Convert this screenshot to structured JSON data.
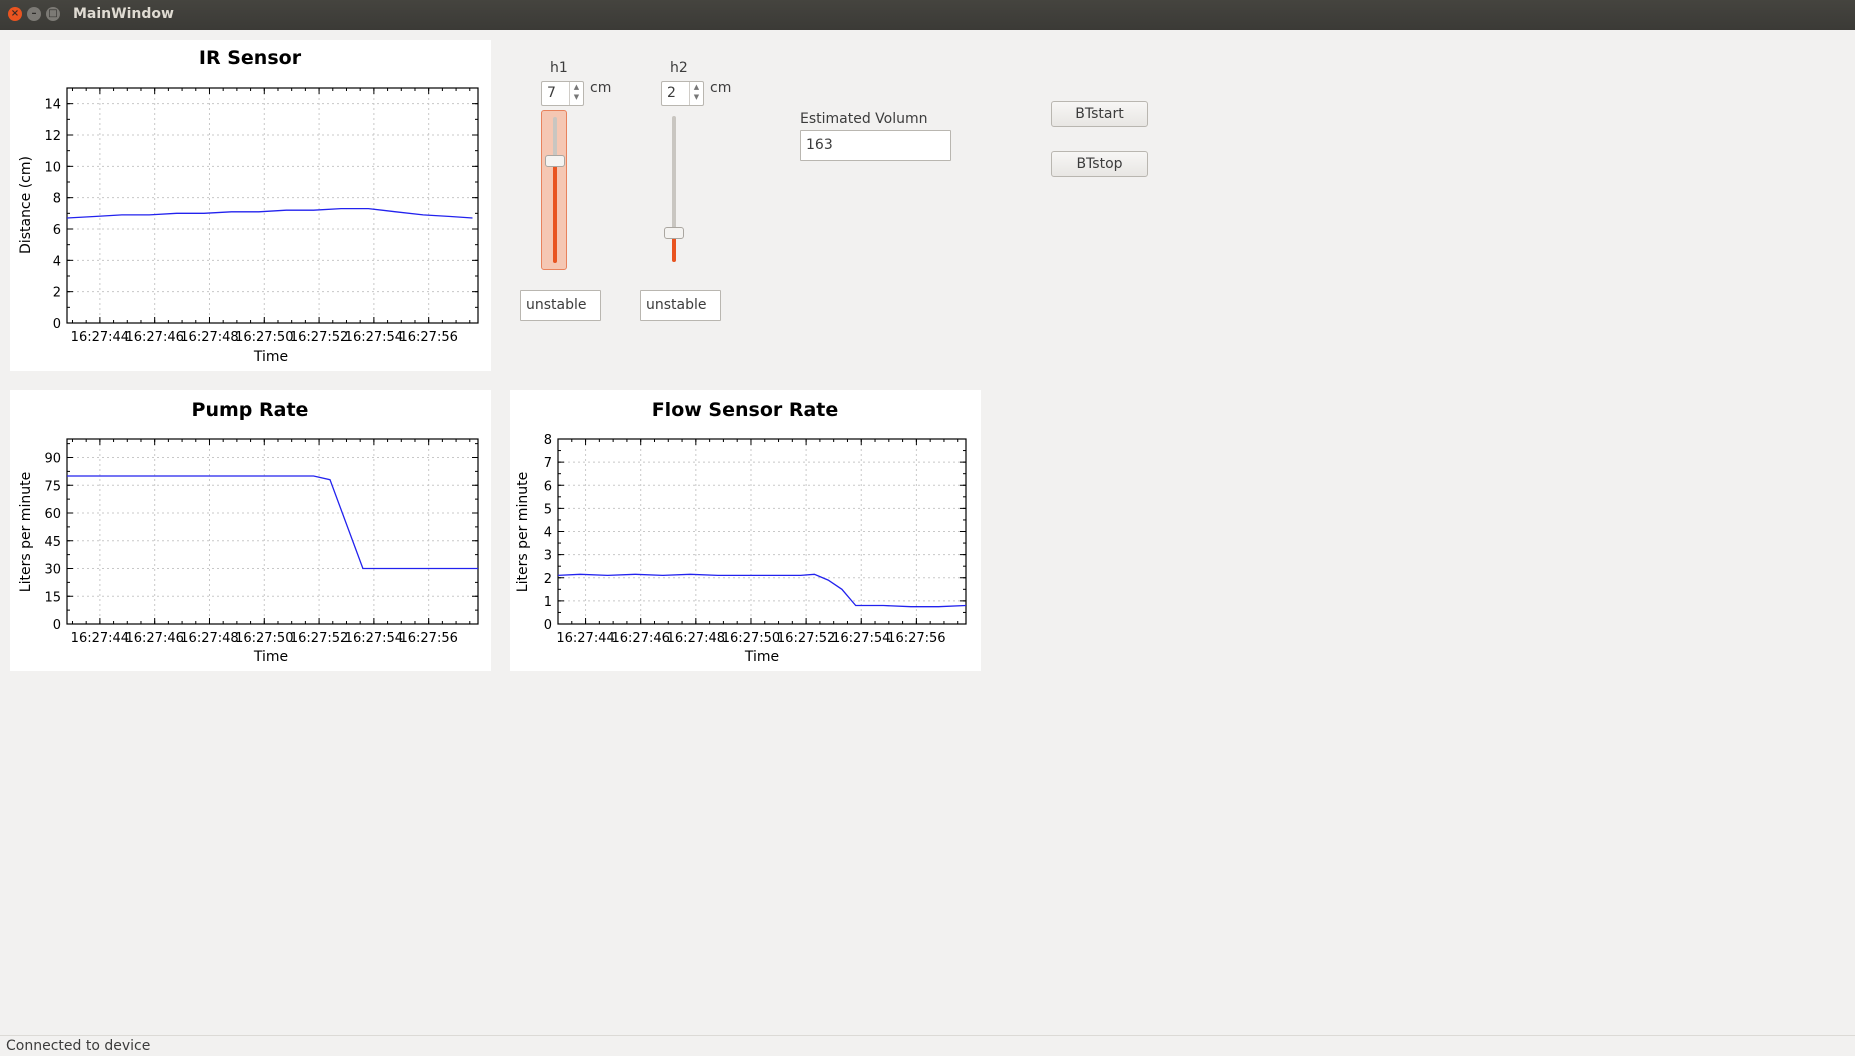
{
  "window": {
    "title": "MainWindow"
  },
  "charts": {
    "ir": {
      "title": "IR Sensor",
      "xlabel": "Time",
      "ylabel": "Distance (cm)",
      "ylim": [
        0,
        15
      ],
      "yticks": [
        0,
        2,
        4,
        6,
        8,
        10,
        12,
        14
      ],
      "xticks": [
        "16:27:44",
        "16:27:46",
        "16:27:48",
        "16:27:50",
        "16:27:52",
        "16:27:54",
        "16:27:56"
      ]
    },
    "pump": {
      "title": "Pump Rate",
      "xlabel": "Time",
      "ylabel": "Liters per minute",
      "ylim": [
        0,
        100
      ],
      "yticks": [
        0,
        15,
        30,
        45,
        60,
        75,
        90
      ],
      "xticks": [
        "16:27:44",
        "16:27:46",
        "16:27:48",
        "16:27:50",
        "16:27:52",
        "16:27:54",
        "16:27:56"
      ]
    },
    "flow": {
      "title": "Flow Sensor Rate",
      "xlabel": "Time",
      "ylabel": "Liters per minute",
      "ylim": [
        0,
        8
      ],
      "yticks": [
        0,
        1,
        2,
        3,
        4,
        5,
        6,
        7,
        8
      ],
      "xticks": [
        "16:27:44",
        "16:27:46",
        "16:27:48",
        "16:27:50",
        "16:27:52",
        "16:27:54",
        "16:27:56"
      ]
    }
  },
  "chart_data": [
    {
      "type": "line",
      "title": "IR Sensor",
      "xlabel": "Time",
      "ylabel": "Distance (cm)",
      "xlim": [
        42.8,
        57.8
      ],
      "ylim": [
        0,
        15
      ],
      "grid": true,
      "color": "#0000ff",
      "x": [
        42.8,
        43.8,
        44.8,
        45.8,
        46.8,
        47.8,
        48.8,
        49.8,
        50.8,
        51.8,
        52.8,
        53.8,
        54.8,
        55.8,
        56.8,
        57.6
      ],
      "y": [
        6.7,
        6.8,
        6.9,
        6.9,
        7.0,
        7.0,
        7.1,
        7.1,
        7.2,
        7.2,
        7.3,
        7.3,
        7.1,
        6.9,
        6.8,
        6.7
      ]
    },
    {
      "type": "line",
      "title": "Pump Rate",
      "xlabel": "Time",
      "ylabel": "Liters per minute",
      "xlim": [
        42.8,
        57.8
      ],
      "ylim": [
        0,
        100
      ],
      "grid": true,
      "color": "#0000ff",
      "x": [
        42.8,
        51.8,
        52.4,
        53.6,
        57.8
      ],
      "y": [
        80,
        80,
        78,
        30,
        30
      ]
    },
    {
      "type": "line",
      "title": "Flow Sensor Rate",
      "xlabel": "Time",
      "ylabel": "Liters per minute",
      "xlim": [
        43.0,
        57.8
      ],
      "ylim": [
        0,
        8
      ],
      "grid": true,
      "color": "#0000ff",
      "x": [
        43.0,
        43.8,
        44.8,
        45.8,
        46.8,
        47.8,
        48.8,
        49.8,
        50.8,
        51.8,
        52.3,
        52.8,
        53.3,
        53.8,
        54.8,
        55.8,
        56.8,
        57.8
      ],
      "y": [
        2.1,
        2.15,
        2.1,
        2.15,
        2.1,
        2.15,
        2.1,
        2.1,
        2.1,
        2.1,
        2.15,
        1.9,
        1.5,
        0.8,
        0.8,
        0.75,
        0.75,
        0.8
      ]
    }
  ],
  "controls": {
    "h1": {
      "label": "h1",
      "value": "7",
      "unit": "cm",
      "slider_fraction": 0.7,
      "status": "unstable"
    },
    "h2": {
      "label": "h2",
      "value": "2",
      "unit": "cm",
      "slider_fraction": 0.2,
      "status": "unstable"
    },
    "volume": {
      "label": "Estimated Volumn",
      "value": "163"
    },
    "start_button": "BTstart",
    "stop_button": "BTstop"
  },
  "colors": {
    "accent": "#e95420",
    "line": "#0000ff"
  },
  "status_bar": {
    "text": "Connected to device"
  }
}
